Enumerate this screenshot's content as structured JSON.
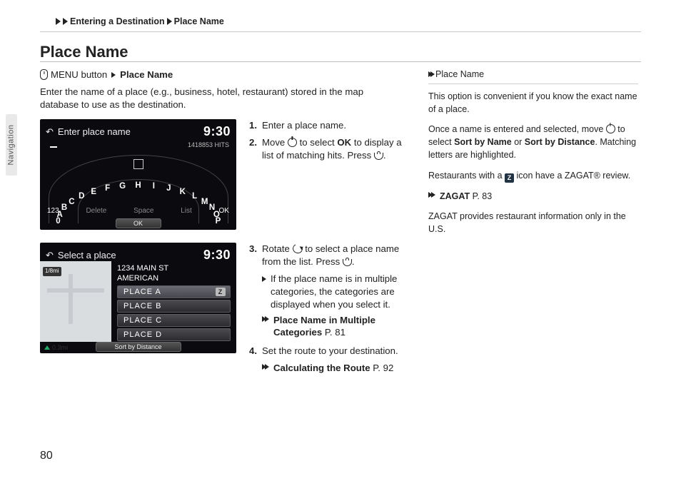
{
  "breadcrumb": {
    "section": "Entering a Destination",
    "page": "Place Name"
  },
  "heading": "Place Name",
  "sideTab": "Navigation",
  "pageNumber": "80",
  "intro": {
    "menuLabel": "MENU button",
    "target": "Place Name",
    "desc": "Enter the name of a place (e.g., business, hotel, restaurant) stored in the map database to use as the destination."
  },
  "steps": {
    "s1": "Enter a place name.",
    "s2a": "Move ",
    "s2b": " to select ",
    "s2ok": "OK",
    "s2c": " to display a list of matching hits. Press ",
    "s2d": ".",
    "s3a": "Rotate ",
    "s3b": " to select a place name from the list. Press ",
    "s3c": ".",
    "s3sub": "If the place name is in multiple categories, the categories are displayed when you select it.",
    "ref1a": "Place Name in Multiple Categories",
    "ref1b": " P. 81",
    "s4": "Set the route to your destination.",
    "ref2a": "Calculating the Route",
    "ref2b": " P. 92"
  },
  "sidebar": {
    "title": "Place Name",
    "p1": "This option is convenient if you know the exact name of a place.",
    "p2a": "Once a name is entered and selected, move ",
    "p2b": " to select ",
    "p2s1": "Sort by Name",
    "p2or": " or ",
    "p2s2": "Sort by Distance",
    "p2c": ". Matching letters are highlighted.",
    "p3a": "Restaurants with a ",
    "p3b": " icon have a ZAGAT® review.",
    "refZa": "ZAGAT",
    "refZb": " P. 83",
    "p4": "ZAGAT provides restaurant information only in the U.S."
  },
  "screen1": {
    "title": "Enter place name",
    "clock": "9:30",
    "hits": "1418853 HITS",
    "letters": [
      "0",
      "A",
      "B",
      "C",
      "D",
      "E",
      "F",
      "G",
      "H",
      "I",
      "J",
      "K",
      "L",
      "M",
      "N",
      "O",
      "P"
    ],
    "bottom": {
      "left": "123",
      "del": "Delete",
      "space": "Space",
      "list": "List",
      "ok": "OK"
    },
    "pill": "OK"
  },
  "screen2": {
    "title": "Select a place",
    "clock": "9:30",
    "scale": "1/8mi",
    "addr1": "1234 MAIN ST",
    "addr2": "AMERICAN",
    "items": [
      "PLACE A",
      "PLACE B",
      "PLACE C",
      "PLACE D"
    ],
    "z": "Z",
    "dist": "0.3mi",
    "sort": "Sort by Distance"
  }
}
